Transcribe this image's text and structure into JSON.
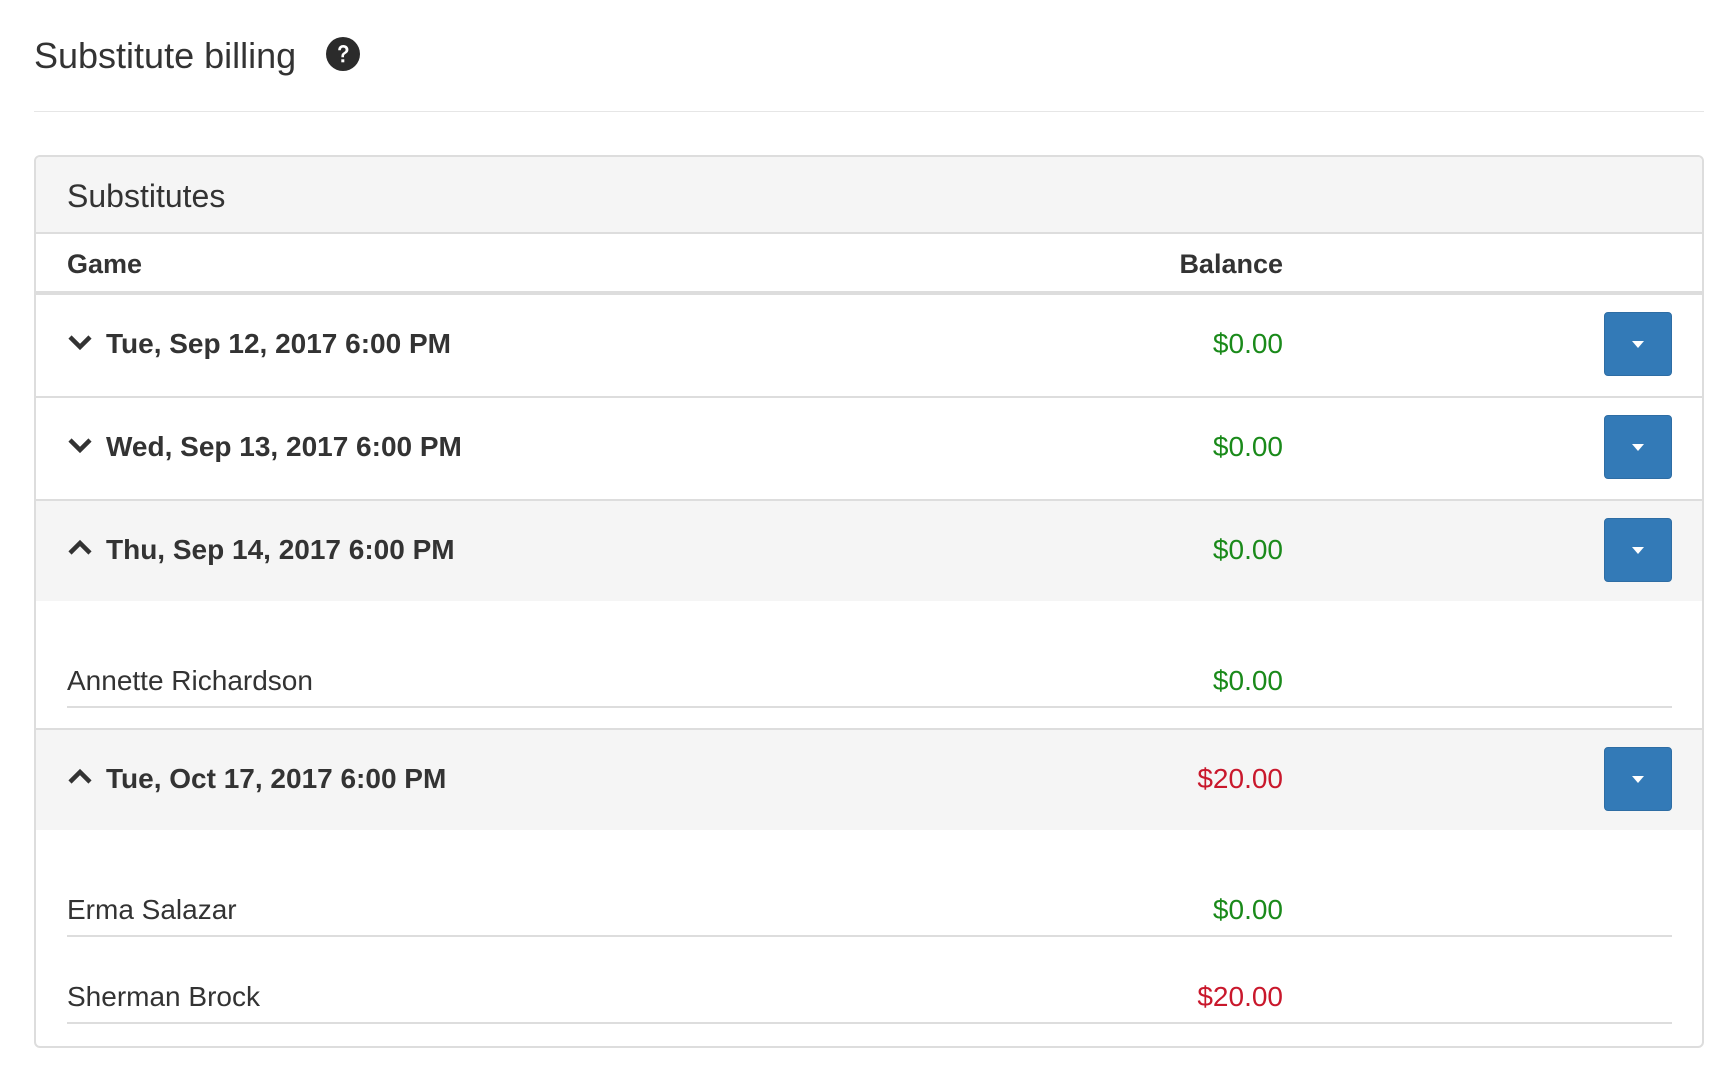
{
  "page": {
    "title": "Substitute billing",
    "help_icon": "question-circle-icon"
  },
  "panel": {
    "title": "Substitutes",
    "columns": {
      "game": "Game",
      "balance": "Balance"
    }
  },
  "colors": {
    "positive": "#1a8a1a",
    "negative": "#c9182c",
    "button": "#337ab7"
  },
  "games": [
    {
      "date": "Tue, Sep 12, 2017 6:00 PM",
      "balance": "$0.00",
      "status": "positive",
      "expanded": false,
      "chevron_icon": "chevron-down-icon",
      "substitutes": []
    },
    {
      "date": "Wed, Sep 13, 2017 6:00 PM",
      "balance": "$0.00",
      "status": "positive",
      "expanded": false,
      "chevron_icon": "chevron-down-icon",
      "substitutes": []
    },
    {
      "date": "Thu, Sep 14, 2017 6:00 PM",
      "balance": "$0.00",
      "status": "positive",
      "expanded": true,
      "chevron_icon": "chevron-up-icon",
      "substitutes": [
        {
          "name": "Annette Richardson",
          "balance": "$0.00",
          "status": "positive"
        }
      ]
    },
    {
      "date": "Tue, Oct 17, 2017 6:00 PM",
      "balance": "$20.00",
      "status": "negative",
      "expanded": true,
      "chevron_icon": "chevron-up-icon",
      "substitutes": [
        {
          "name": "Erma Salazar",
          "balance": "$0.00",
          "status": "positive"
        },
        {
          "name": "Sherman Brock",
          "balance": "$20.00",
          "status": "negative"
        }
      ]
    }
  ]
}
